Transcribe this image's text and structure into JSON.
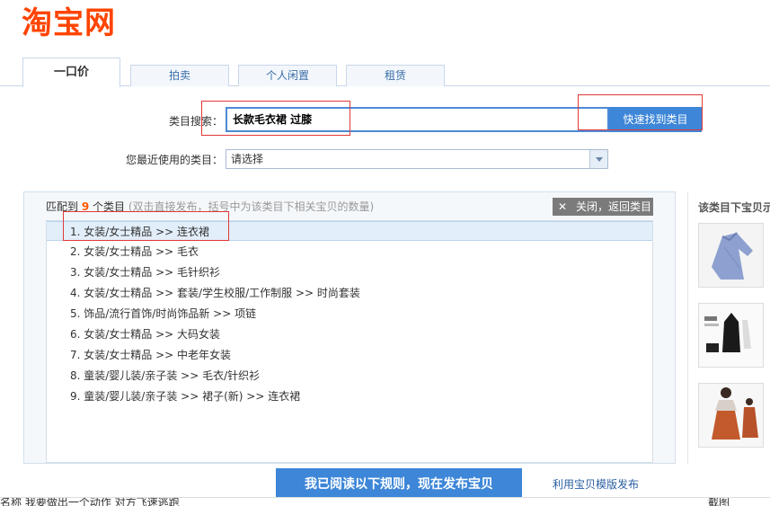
{
  "logo": {
    "text": "淘宝网"
  },
  "tabs": [
    {
      "label": "一口价"
    },
    {
      "label": "拍卖"
    },
    {
      "label": "个人闲置"
    },
    {
      "label": "租赁"
    }
  ],
  "form": {
    "search_label": "类目搜索：",
    "search_value": "长款毛衣裙 过膝",
    "search_button": "快速找到类目",
    "recent_label": "您最近使用的类目：",
    "recent_value": "请选择"
  },
  "results": {
    "prefix": "匹配到",
    "count": "9",
    "unit": "个类目",
    "hint": "(双击直接发布，括号中为该类目下相关宝贝的数量)",
    "close_label": "关闭，返回类目",
    "selected_index": 0,
    "items": [
      "1.  女装/女士精品 >> 连衣裙",
      "2.  女装/女士精品 >> 毛衣",
      "3.  女装/女士精品 >> 毛针织衫",
      "4.  女装/女士精品 >> 套装/学生校服/工作制服 >> 时尚套装",
      "5.  饰品/流行首饰/时尚饰品新 >> 项链",
      "6.  女装/女士精品 >> 大码女装",
      "7.  女装/女士精品 >> 中老年女装",
      "8.  童装/婴儿装/亲子装 >> 毛衣/针织衫",
      "9.  童装/婴儿装/亲子装 >> 裙子(新) >> 连衣裙"
    ]
  },
  "side": {
    "title": "该类目下宝贝示"
  },
  "bottom": {
    "publish_button": "我已阅读以下规则，现在发布宝贝",
    "template_link": "利用宝贝模版发布",
    "strip_text": "名称  我要做出一个动作 对方飞速逃跑",
    "strip_right": "截图"
  }
}
